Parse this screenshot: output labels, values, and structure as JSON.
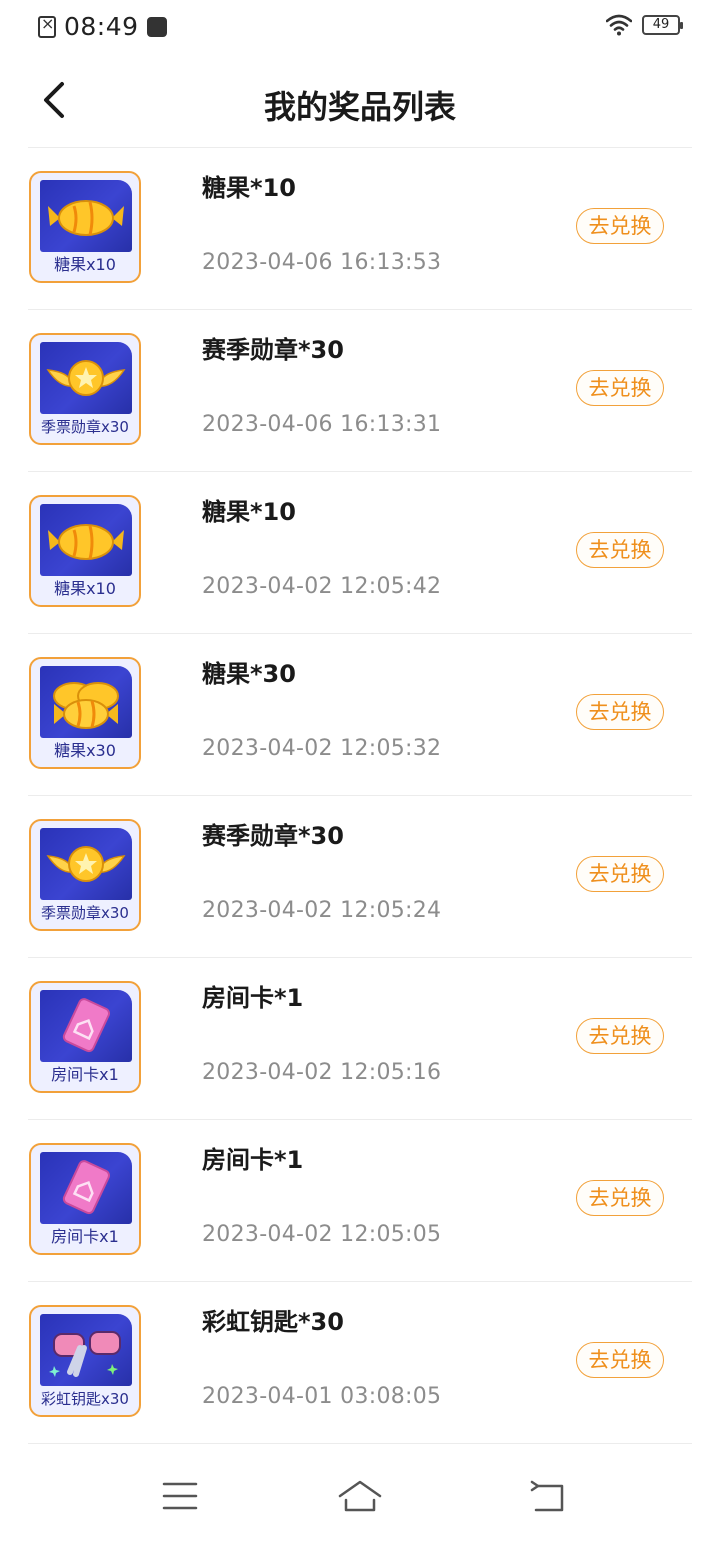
{
  "status_bar": {
    "time": "08:49",
    "battery": "49",
    "icons": [
      "notification-x-icon",
      "game-icon",
      "wifi-icon",
      "battery-icon"
    ]
  },
  "header": {
    "title": "我的奖品列表",
    "back_icon": "chevron-left-icon"
  },
  "redeem_label": "去兑换",
  "items": [
    {
      "name": "糖果*10",
      "time": "2023-04-06 16:13:53",
      "thumb_caption": "糖果x10",
      "icon": "candy-icon"
    },
    {
      "name": "赛季勋章*30",
      "time": "2023-04-06 16:13:31",
      "thumb_caption": "季票勋章x30",
      "icon": "medal-icon"
    },
    {
      "name": "糖果*10",
      "time": "2023-04-02 12:05:42",
      "thumb_caption": "糖果x10",
      "icon": "candy-icon"
    },
    {
      "name": "糖果*30",
      "time": "2023-04-02 12:05:32",
      "thumb_caption": "糖果x30",
      "icon": "candies-icon"
    },
    {
      "name": "赛季勋章*30",
      "time": "2023-04-02 12:05:24",
      "thumb_caption": "季票勋章x30",
      "icon": "medal-icon"
    },
    {
      "name": "房间卡*1",
      "time": "2023-04-02 12:05:16",
      "thumb_caption": "房间卡x1",
      "icon": "room-card-icon"
    },
    {
      "name": "房间卡*1",
      "time": "2023-04-02 12:05:05",
      "thumb_caption": "房间卡x1",
      "icon": "room-card-icon"
    },
    {
      "name": "彩虹钥匙*30",
      "time": "2023-04-01 03:08:05",
      "thumb_caption": "彩虹钥匙x30",
      "icon": "rainbow-key-icon"
    }
  ],
  "colors": {
    "accent": "#ef8f1c",
    "accent_border": "#f2a13a",
    "thumb_bg": "#2a33b8",
    "caption": "#2b2f8f",
    "time_text": "#8c8c8c"
  },
  "nav_bar": {
    "buttons": [
      "menu-icon",
      "home-icon",
      "back-icon"
    ]
  }
}
